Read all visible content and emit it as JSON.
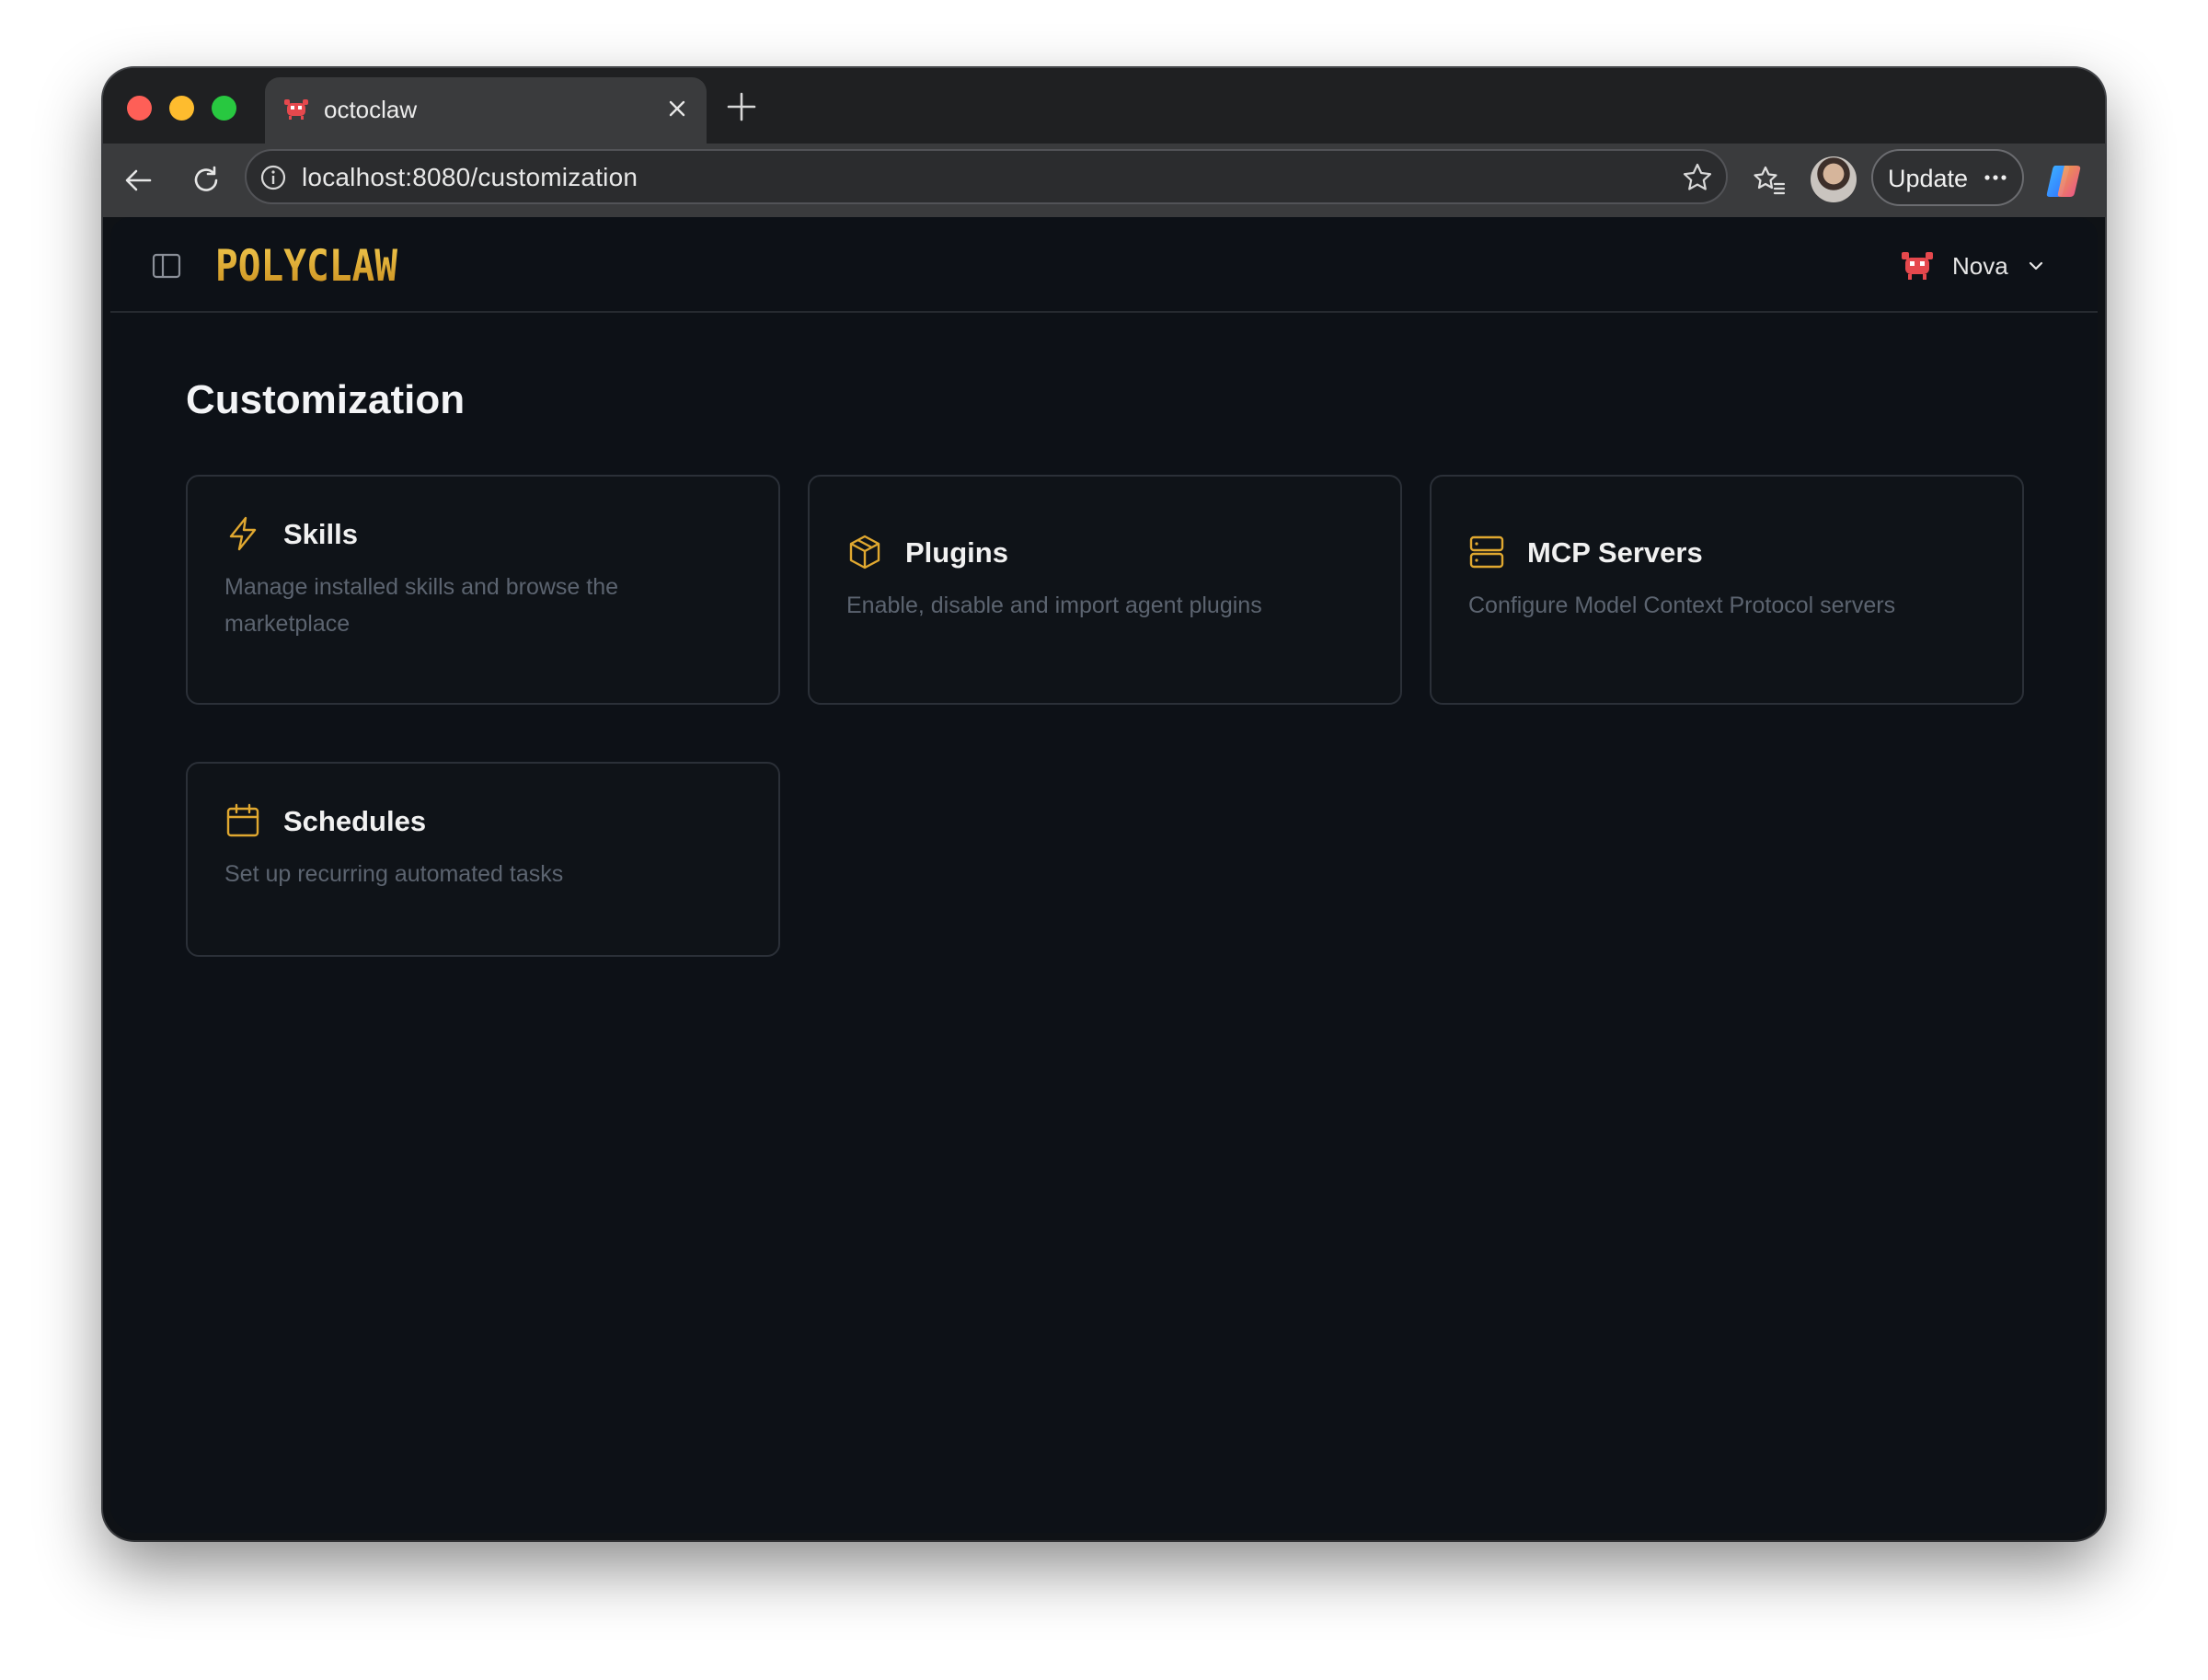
{
  "browser": {
    "tab": {
      "title": "octoclaw"
    },
    "address_bar": {
      "url": "localhost:8080/customization"
    },
    "update_button": {
      "label": "Update"
    }
  },
  "app": {
    "logo_text": "POLYCLAW",
    "persona": {
      "name": "Nova"
    },
    "page_title": "Customization",
    "cards": [
      {
        "title": "Skills",
        "description": "Manage installed skills and browse the marketplace",
        "icon": "lightning-icon"
      },
      {
        "title": "Plugins",
        "description": "Enable, disable and import agent plugins",
        "icon": "package-icon"
      },
      {
        "title": "MCP Servers",
        "description": "Configure Model Context Protocol servers",
        "icon": "server-icon"
      },
      {
        "title": "Schedules",
        "description": "Set up recurring automated tasks",
        "icon": "calendar-icon"
      }
    ]
  },
  "colors": {
    "accent": "#e0a830",
    "background": "#0d1117",
    "card_border": "#2b3038",
    "muted_text": "#5c6470"
  }
}
